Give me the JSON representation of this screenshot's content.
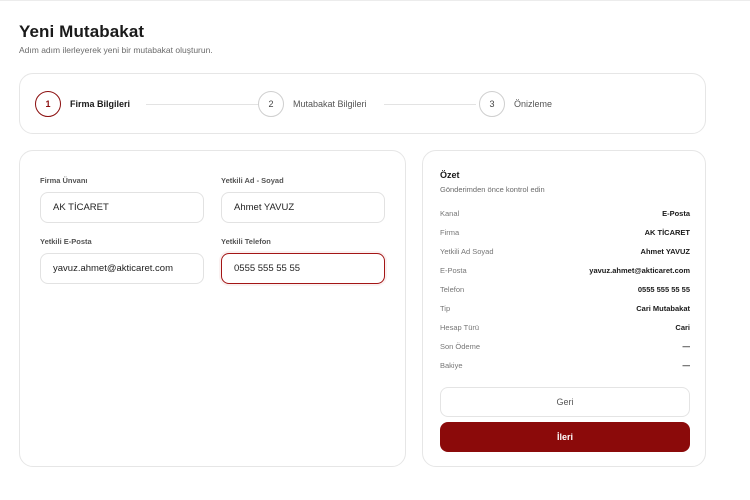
{
  "header": {
    "title": "Yeni Mutabakat",
    "subtitle": "Adım adım ilerleyerek yeni bir mutabakat oluşturun."
  },
  "stepper": {
    "steps": [
      {
        "number": "1",
        "label": "Firma Bilgileri",
        "active": true
      },
      {
        "number": "2",
        "label": "Mutabakat Bilgileri",
        "active": false
      },
      {
        "number": "3",
        "label": "Önizleme",
        "active": false
      }
    ]
  },
  "form": {
    "company_name": {
      "label": "Firma Ünvanı",
      "value": "AK TİCARET"
    },
    "contact_name": {
      "label": "Yetkili Ad - Soyad",
      "value": "Ahmet YAVUZ"
    },
    "contact_email": {
      "label": "Yetkili E-Posta",
      "value": "yavuz.ahmet@akticaret.com"
    },
    "contact_phone": {
      "label": "Yetkili Telefon",
      "value": "0555 555 55 55"
    }
  },
  "summary": {
    "title": "Özet",
    "subtitle": "Gönderimden önce kontrol edin",
    "rows": [
      {
        "key": "Kanal",
        "value": "E-Posta"
      },
      {
        "key": "Firma",
        "value": "AK TİCARET"
      },
      {
        "key": "Yetkili Ad Soyad",
        "value": "Ahmet YAVUZ"
      },
      {
        "key": "E-Posta",
        "value": "yavuz.ahmet@akticaret.com"
      },
      {
        "key": "Telefon",
        "value": "0555 555 55 55"
      },
      {
        "key": "Tip",
        "value": "Cari Mutabakat"
      },
      {
        "key": "Hesap Türü",
        "value": "Cari"
      },
      {
        "key": "Son Ödeme",
        "value": "—"
      },
      {
        "key": "Bakiye",
        "value": "—"
      }
    ],
    "back_label": "Geri",
    "next_label": "İleri"
  },
  "colors": {
    "accent": "#8b0a0a",
    "border": "#e6e6e6"
  }
}
